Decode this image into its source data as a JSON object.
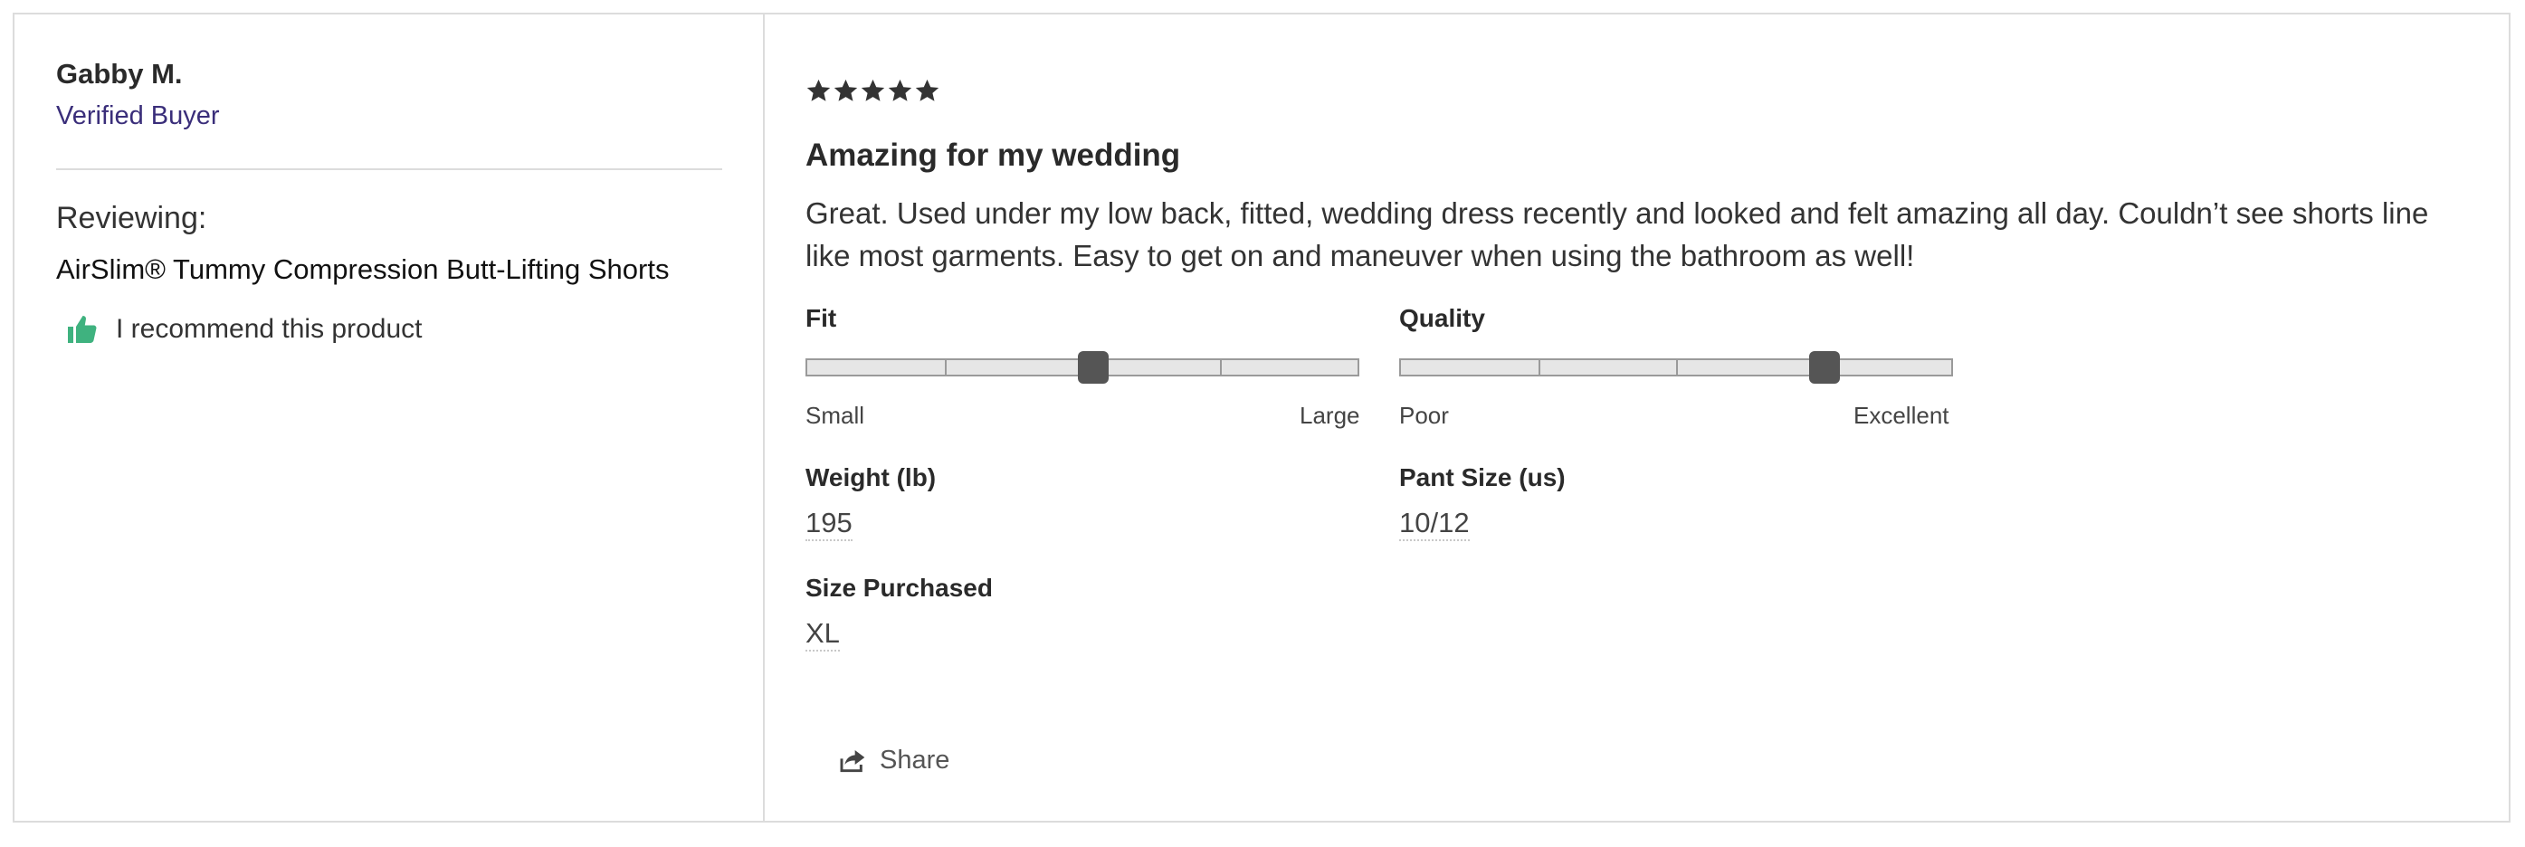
{
  "reviewer": {
    "name": "Gabby M.",
    "badge": "Verified Buyer"
  },
  "reviewing": {
    "label": "Reviewing:",
    "product": "AirSlim® Tummy Compression Butt-Lifting Shorts"
  },
  "recommend": {
    "icon": "thumbs-up-icon",
    "text": "I recommend this product",
    "icon_color": "#3fb27f"
  },
  "review": {
    "rating": 5,
    "rating_max": 5,
    "title": "Amazing for my wedding",
    "body": "Great. Used under my low back, fitted, wedding dress recently and looked and felt amazing all day. Couldn’t see shorts line like most garments. Easy to get on and maneuver when using the bathroom as well!"
  },
  "sliders": {
    "fit": {
      "label": "Fit",
      "min_label": "Small",
      "max_label": "Large",
      "value_fraction": 0.52
    },
    "quality": {
      "label": "Quality",
      "min_label": "Poor",
      "max_label": "Excellent",
      "value_fraction": 0.77
    }
  },
  "attributes": {
    "weight": {
      "label": "Weight (lb)",
      "value": "195"
    },
    "pant_size": {
      "label": "Pant Size (us)",
      "value": "10/12"
    },
    "size_purchased": {
      "label": "Size Purchased",
      "value": "XL"
    }
  },
  "actions": {
    "share_label": "Share",
    "share_icon": "share-icon"
  },
  "colors": {
    "verified": "#3a2e7a",
    "star": "#333333",
    "slider_handle": "#555555"
  }
}
